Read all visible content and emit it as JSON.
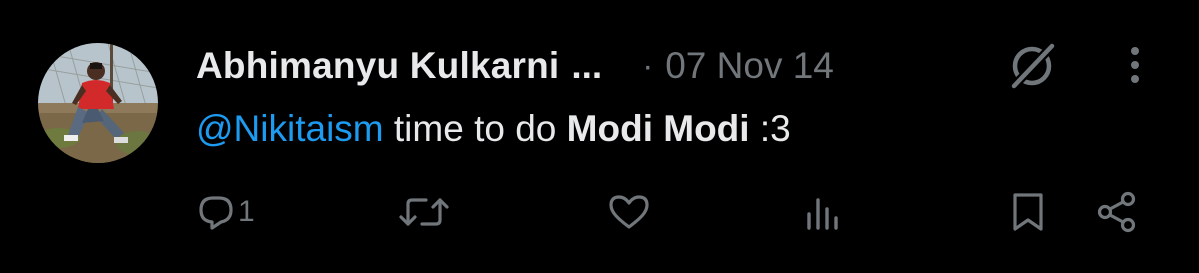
{
  "tweet": {
    "author": {
      "display_name": "Abhimanyu Kulkarni",
      "name_truncation": "...",
      "avatar_icon": "profile-photo"
    },
    "separator": "·",
    "timestamp": "07 Nov 14",
    "text": {
      "mention": "@Nikitaism",
      "plain_1": "time to do",
      "bold": "Modi Modi",
      "plain_2": ":3"
    },
    "actions": {
      "reply_count": "1",
      "reply_icon": "reply-icon",
      "retweet_icon": "retweet-icon",
      "like_icon": "heart-icon",
      "views_icon": "views-icon",
      "bookmark_icon": "bookmark-icon",
      "share_icon": "share-icon"
    },
    "colors": {
      "background": "#000000",
      "text": "#e7e9ea",
      "muted": "#71767b",
      "link": "#1d9bf0"
    }
  }
}
